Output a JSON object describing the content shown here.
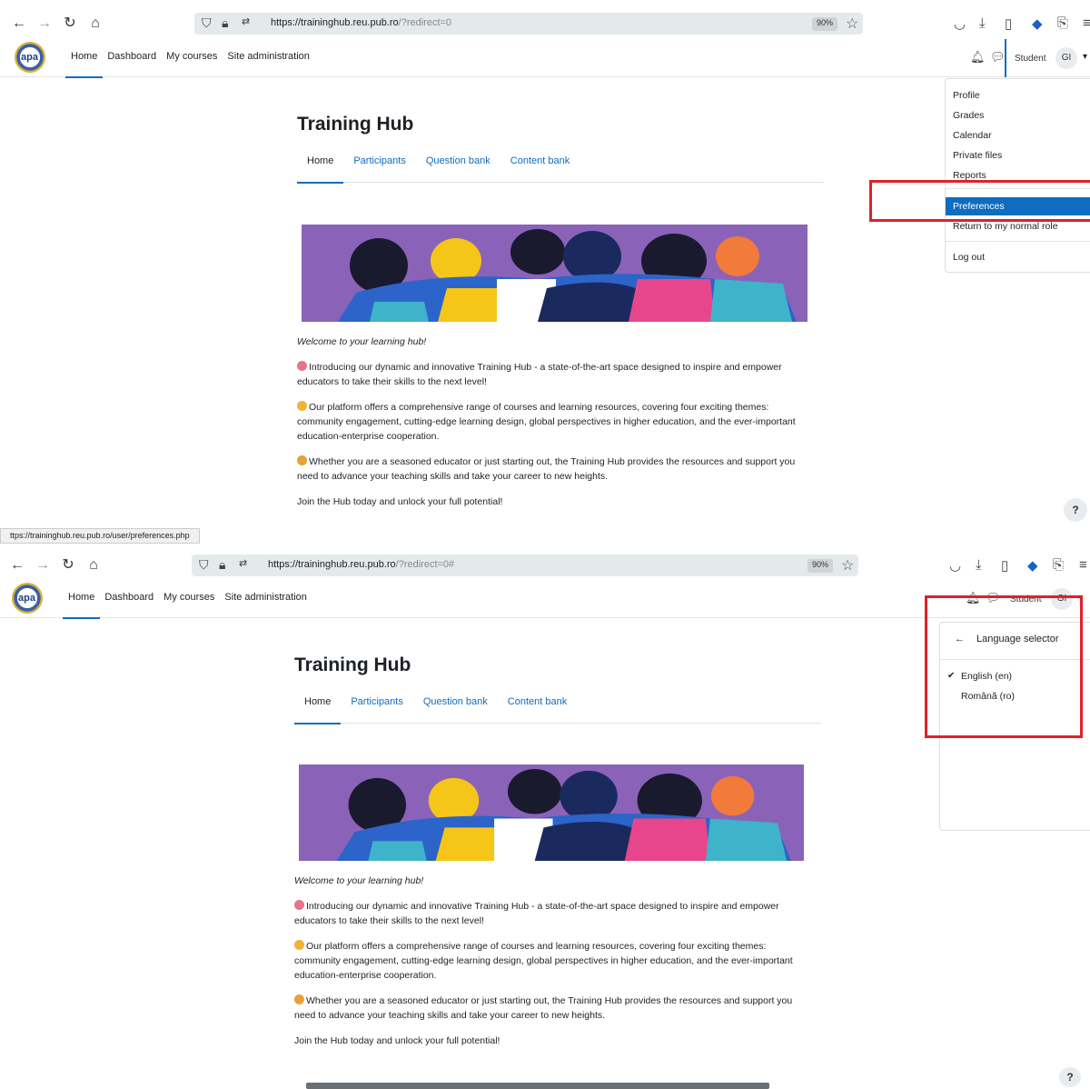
{
  "browser": {
    "url_host_1": "https://traininghub.reu.pub.ro",
    "url_path_1": "/?redirect=0",
    "url_host_2": "https://traininghub.reu.pub.ro",
    "url_path_2": "/?redirect=0#",
    "zoom": "90%",
    "status_url": "ttps://traininghub.reu.pub.ro/user/preferences.php"
  },
  "site": {
    "logo_text": "apa",
    "nav": [
      "Home",
      "Dashboard",
      "My courses",
      "Site administration"
    ],
    "user_role": "Student",
    "user_initials": "GI"
  },
  "course": {
    "title": "Training Hub",
    "tabs": [
      "Home",
      "Participants",
      "Question bank",
      "Content bank"
    ]
  },
  "content": {
    "welcome": "Welcome to your learning hub!",
    "p1": "Introducing our dynamic and innovative Training Hub - a state-of-the-art space designed to inspire and empower educators to take their skills to the next level!",
    "p2": "Our platform offers a comprehensive range of courses and learning resources, covering four exciting themes: community engagement, cutting-edge learning design, global perspectives in higher education, and the ever-important education-enterprise cooperation.",
    "p3": "Whether you are a seasoned educator or just starting out, the Training Hub provides the resources and support you need to advance your teaching skills and take your career to new heights.",
    "p4": "Join the Hub today and unlock your full potential!"
  },
  "user_menu": {
    "items": [
      "Profile",
      "Grades",
      "Calendar",
      "Private files",
      "Reports"
    ],
    "highlighted": "Preferences",
    "return_role": "Return to my normal role",
    "logout": "Log out"
  },
  "language_menu": {
    "title": "Language selector",
    "options": [
      "English (en)",
      "Română (ro)"
    ],
    "selected": "English (en)"
  },
  "help_label": "?",
  "colors": {
    "accent": "#0f6cbf",
    "highlight_box": "#e0202a",
    "banner": "#8a63b8"
  }
}
